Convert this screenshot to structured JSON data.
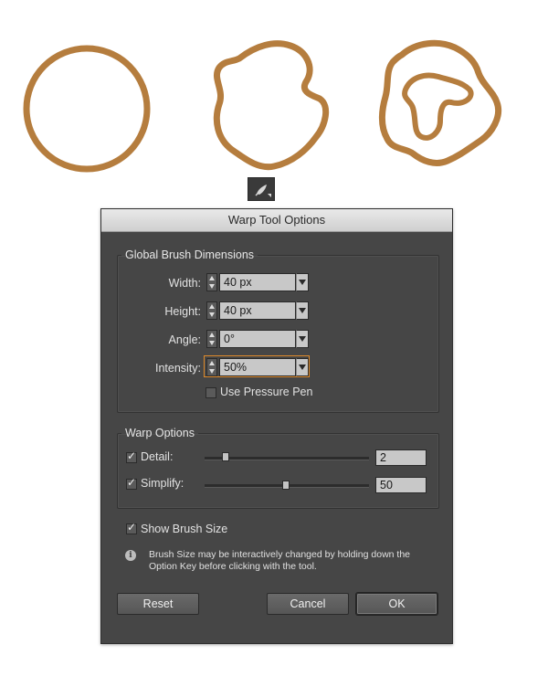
{
  "colors": {
    "shape_stroke": "#b57d3e",
    "dialog_bg": "#464646",
    "focus": "#e08b2a"
  },
  "icons": {
    "tool": "warp-tool-icon",
    "info": "info-icon"
  },
  "dialog": {
    "title": "Warp Tool Options",
    "brush": {
      "legend": "Global Brush Dimensions",
      "width": {
        "label": "Width:",
        "value": "40 px"
      },
      "height": {
        "label": "Height:",
        "value": "40 px"
      },
      "angle": {
        "label": "Angle:",
        "value": "0°"
      },
      "intensity": {
        "label": "Intensity:",
        "value": "50%"
      },
      "pressure_label": "Use Pressure Pen",
      "pressure_checked": false
    },
    "warp": {
      "legend": "Warp Options",
      "detail": {
        "label": "Detail:",
        "value": "2",
        "checked": true,
        "level": 0.13
      },
      "simplify": {
        "label": "Simplify:",
        "value": "50",
        "checked": true,
        "level": 0.5
      }
    },
    "show_brush_label": "Show Brush Size",
    "show_brush_checked": true,
    "info_line1": "Brush Size may be interactively changed by holding down the",
    "info_line2": "Option Key before clicking with the tool.",
    "buttons": {
      "reset": "Reset",
      "cancel": "Cancel",
      "ok": "OK"
    }
  }
}
